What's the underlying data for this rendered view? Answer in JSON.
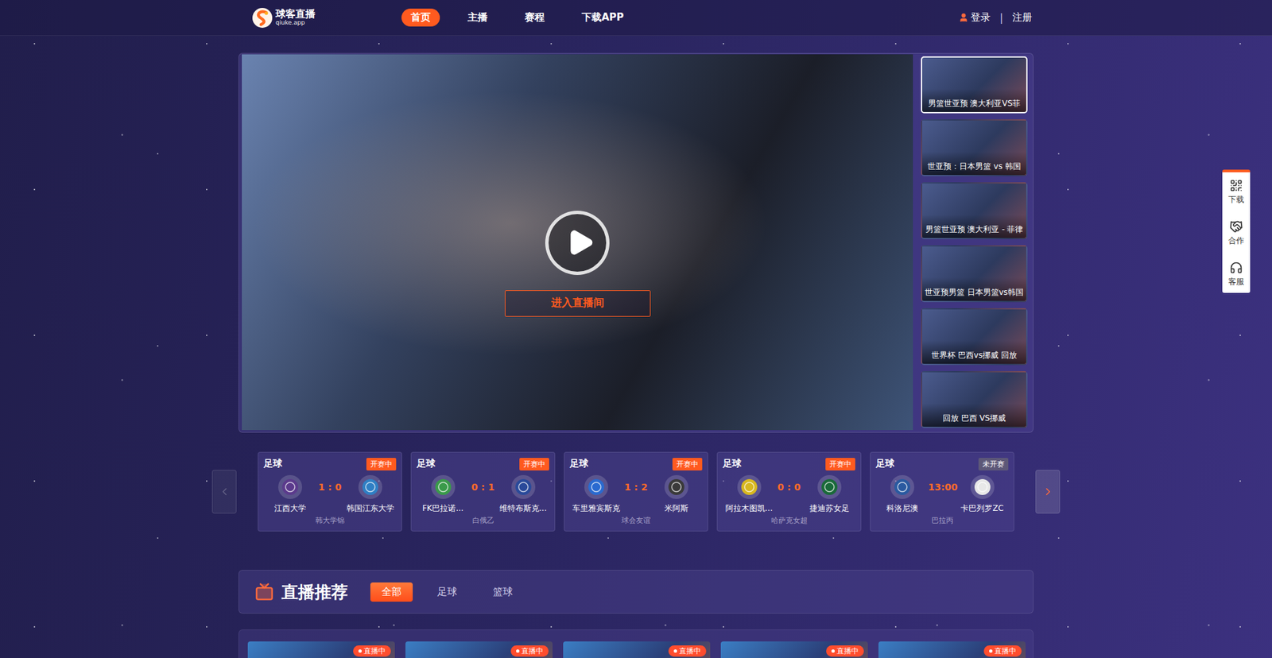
{
  "header": {
    "logo": {
      "name": "球客直播",
      "domain": "qiuke.app"
    },
    "nav": [
      {
        "label": "首页",
        "selected": true
      },
      {
        "label": "主播",
        "selected": false
      },
      {
        "label": "赛程",
        "selected": false
      },
      {
        "label": "下载APP",
        "selected": false
      }
    ],
    "login": "登录",
    "divider": "|",
    "register": "注册"
  },
  "player": {
    "enter_button": "进入直播间"
  },
  "side_streams": [
    {
      "title": "男篮世亚预 澳大利亚VS菲",
      "selected": true
    },
    {
      "title": "世亚预：日本男篮 vs 韩国",
      "selected": false
    },
    {
      "title": "男篮世亚预 澳大利亚 - 菲律",
      "selected": false
    },
    {
      "title": "世亚预男篮 日本男篮vs韩国",
      "selected": false
    },
    {
      "title": "世界杯 巴西vs挪威 回放",
      "selected": false
    },
    {
      "title": "回放 巴西 VS挪威",
      "selected": false
    }
  ],
  "match_strip": {
    "prev_disabled": true,
    "next_disabled": false
  },
  "matches": [
    {
      "sport": "足球",
      "status": "开赛中",
      "live": true,
      "home": {
        "name": "江西大学",
        "logo_color": "#5b3a8c"
      },
      "score": "1 : 0",
      "away": {
        "name": "韩国江东大学",
        "logo_color": "#2f7fc4"
      },
      "league": "韩大学锦"
    },
    {
      "sport": "足球",
      "status": "开赛中",
      "live": true,
      "home": {
        "name": "FK巴拉诺...",
        "logo_color": "#3a9a4a"
      },
      "score": "0 : 1",
      "away": {
        "name": "维特布斯克...",
        "logo_color": "#2a4a9a"
      },
      "league": "白俄乙"
    },
    {
      "sport": "足球",
      "status": "开赛中",
      "live": true,
      "home": {
        "name": "车里雅宾斯克",
        "logo_color": "#2a6ad0"
      },
      "score": "1 : 2",
      "away": {
        "name": "米阿斯",
        "logo_color": "#3a3a3a"
      },
      "league": "球会友谊"
    },
    {
      "sport": "足球",
      "status": "开赛中",
      "live": true,
      "home": {
        "name": "阿拉木图凯...",
        "logo_color": "#d8b820"
      },
      "score": "0 : 0",
      "away": {
        "name": "捷迪苏女足",
        "logo_color": "#1a6a3a"
      },
      "league": "哈萨克女超"
    },
    {
      "sport": "足球",
      "status": "未开赛",
      "live": false,
      "home": {
        "name": "科洛尼澳",
        "logo_color": "#2a5aa0"
      },
      "score": "13:00",
      "away": {
        "name": "卡巴列罗ZC",
        "logo_color": "#e8e8e8"
      },
      "league": "巴拉丙"
    }
  ],
  "recommend": {
    "title": "直播推荐",
    "tabs": [
      {
        "label": "全部",
        "selected": true
      },
      {
        "label": "足球",
        "selected": false
      },
      {
        "label": "篮球",
        "selected": false
      }
    ]
  },
  "live_cards": [
    {
      "badge": "直播中"
    },
    {
      "badge": "直播中"
    },
    {
      "badge": "直播中"
    },
    {
      "badge": "直播中"
    },
    {
      "badge": "直播中"
    }
  ],
  "float_menu": [
    {
      "label": "下载",
      "kind": "qr"
    },
    {
      "label": "合作",
      "kind": "handshake"
    },
    {
      "label": "客服",
      "kind": "service"
    }
  ]
}
